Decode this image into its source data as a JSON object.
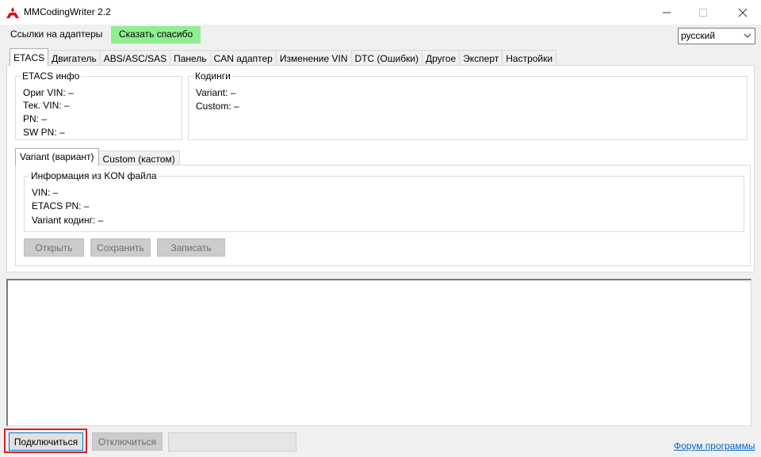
{
  "window": {
    "title": "MMCodingWriter 2.2",
    "icons": {
      "app": "mitsubishi-logo-icon",
      "minimize": "minimize-icon",
      "maximize": "maximize-icon",
      "close": "close-icon"
    }
  },
  "menu": {
    "links_label": "Ссылки на адаптеры",
    "thanks_label": "Сказать спасибо",
    "thanks_color": "#90ee90"
  },
  "language": {
    "selected": "русский"
  },
  "tabs": [
    {
      "label": "ETACS"
    },
    {
      "label": "Двигатель"
    },
    {
      "label": "ABS/ASC/SAS"
    },
    {
      "label": "Панель"
    },
    {
      "label": "CAN адаптер"
    },
    {
      "label": "Изменение VIN"
    },
    {
      "label": "DTC (Ошибки)"
    },
    {
      "label": "Другое"
    },
    {
      "label": "Эксперт"
    },
    {
      "label": "Настройки"
    }
  ],
  "etacs_info": {
    "title": "ETACS инфо",
    "orig_vin": "Ориг VIN: –",
    "tek_vin": "Тек. VIN: –",
    "pn": "PN:   –",
    "sw_pn": "SW PN:   –"
  },
  "codings": {
    "title": "Кодинги",
    "variant": "Variant:   –",
    "custom": "Custom:   –"
  },
  "subtabs": [
    {
      "label": "Variant (вариант)"
    },
    {
      "label": "Custom (кастом)"
    }
  ],
  "kon_info": {
    "title": "Информация из KON файла",
    "vin": "VIN:   –",
    "etacs_pn": "ETACS PN:   –",
    "variant_coding": "Variant кодинг:   –"
  },
  "actions": {
    "open": "Открыть",
    "save": "Сохранить",
    "write": "Записать"
  },
  "bottom": {
    "connect": "Подключиться",
    "disconnect": "Отключиться",
    "forum": "Форум программы",
    "highlight_color": "#e02020"
  }
}
